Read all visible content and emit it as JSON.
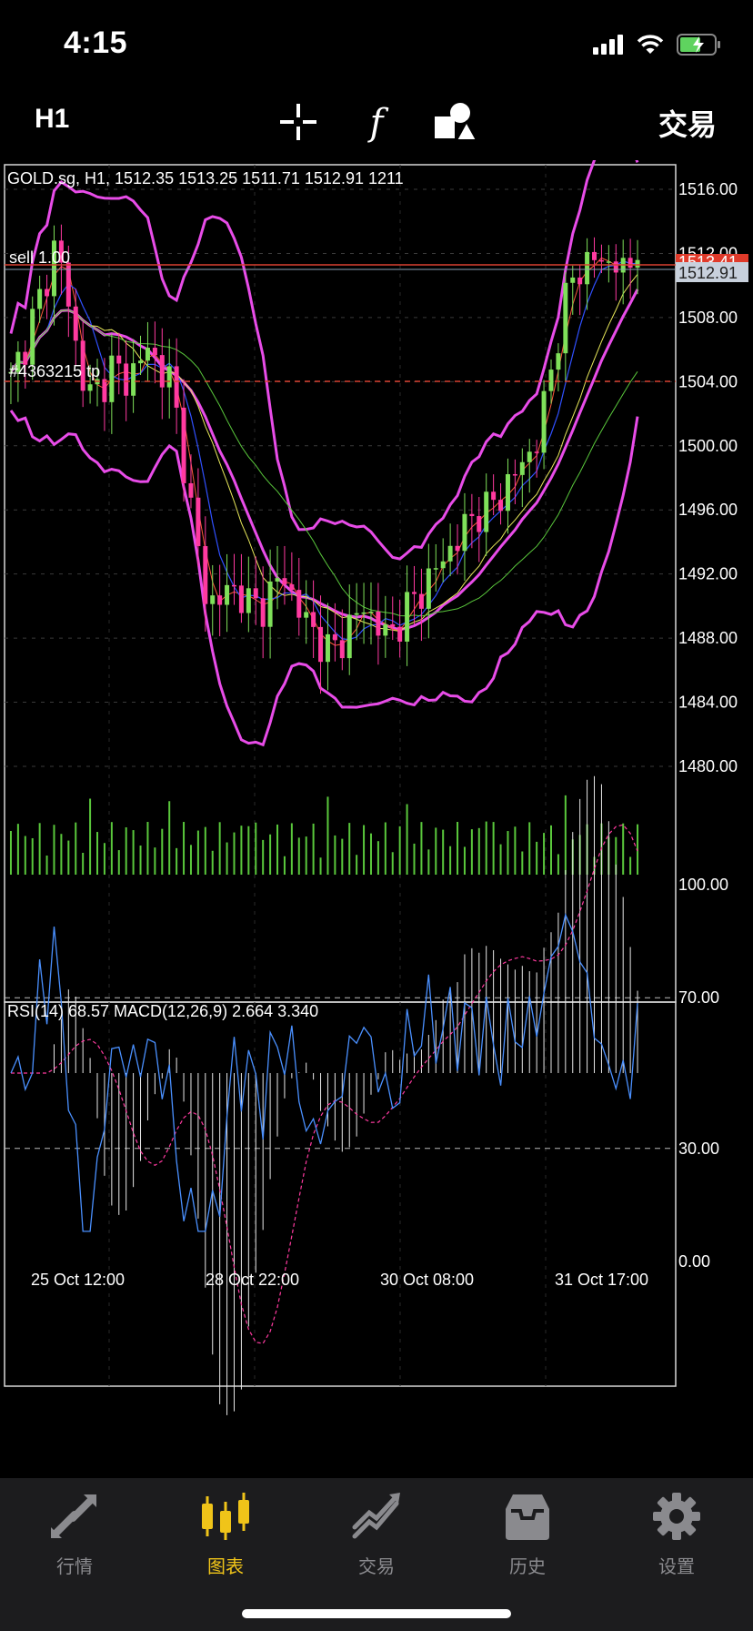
{
  "status_bar": {
    "time": "4:15"
  },
  "toolbar": {
    "timeframe": "H1",
    "tools": [
      "crosshair-icon",
      "function-icon",
      "objects-icon"
    ],
    "trade_label": "交易"
  },
  "chart": {
    "symbol_info": "GOLD.sg, H1, 1512.35 1513.25 1511.71 1512.91 1211",
    "sell_line_label": "sell 1.00",
    "tp_line_label": "#4363215 tp",
    "bid_price_label": "1512.91",
    "sell_price_label": "1513.41",
    "price_ticks": [
      "1516.00",
      "1512.00",
      "1508.00",
      "1504.00",
      "1500.00",
      "1496.00",
      "1492.00",
      "1488.00",
      "1484.00",
      "1480.00"
    ],
    "indicator_info": "RSI(14) 68.57 MACD(12,26,9) 2.664 3.340",
    "indicator_ticks": [
      "100.00",
      "70.00",
      "30.00",
      "0.00"
    ],
    "time_labels": [
      "25 Oct 12:00",
      "28 Oct 22:00",
      "30 Oct 08:00",
      "31 Oct 17:00"
    ],
    "colors": {
      "up": "#7fe05a",
      "down": "#ff3aa0",
      "bollinger": "#e84ce8",
      "ma_fast": "#ff5a3c",
      "ma_blue": "#3050ff",
      "ma_yellow": "#e8e85a",
      "ma_green": "#5ac83c",
      "sell_line": "#d84030",
      "rsi": "#4a90ff"
    }
  },
  "tabbar": {
    "items": [
      {
        "label": "行情",
        "icon": "quotes-arrows-icon",
        "active": false
      },
      {
        "label": "图表",
        "icon": "chart-candles-icon",
        "active": true
      },
      {
        "label": "交易",
        "icon": "trade-trend-icon",
        "active": false
      },
      {
        "label": "历史",
        "icon": "history-inbox-icon",
        "active": false
      },
      {
        "label": "设置",
        "icon": "settings-gear-icon",
        "active": false
      }
    ]
  },
  "chart_data": {
    "type": "candlestick",
    "symbol": "GOLD.sg",
    "timeframe": "H1",
    "ohlc_last": {
      "open": 1512.35,
      "high": 1513.25,
      "low": 1511.71,
      "close": 1512.91,
      "volume": 1211
    },
    "y_range": [
      1477,
      1518
    ],
    "x_labels": [
      "25 Oct 12:00",
      "28 Oct 22:00",
      "30 Oct 08:00",
      "31 Oct 17:00"
    ],
    "closes": [
      1504,
      1506,
      1508,
      1510,
      1513,
      1509,
      1505,
      1503,
      1504,
      1505,
      1504,
      1505,
      1506,
      1505,
      1504,
      1500,
      1495,
      1491,
      1490,
      1491,
      1491,
      1490,
      1490,
      1491,
      1492,
      1490,
      1489,
      1488,
      1487,
      1488,
      1489,
      1490,
      1489,
      1488,
      1489,
      1490,
      1491,
      1492,
      1493,
      1494,
      1495,
      1496,
      1496,
      1497,
      1498,
      1499,
      1500,
      1503,
      1507,
      1510,
      1511,
      1512,
      1511,
      1512,
      1510,
      1512.91
    ],
    "sell_level": 1513.41,
    "tp_level": 1507.6,
    "rsi_last": 68.57,
    "macd": {
      "main": 2.664,
      "signal": 3.34
    },
    "indicator_range": [
      0,
      100
    ]
  }
}
